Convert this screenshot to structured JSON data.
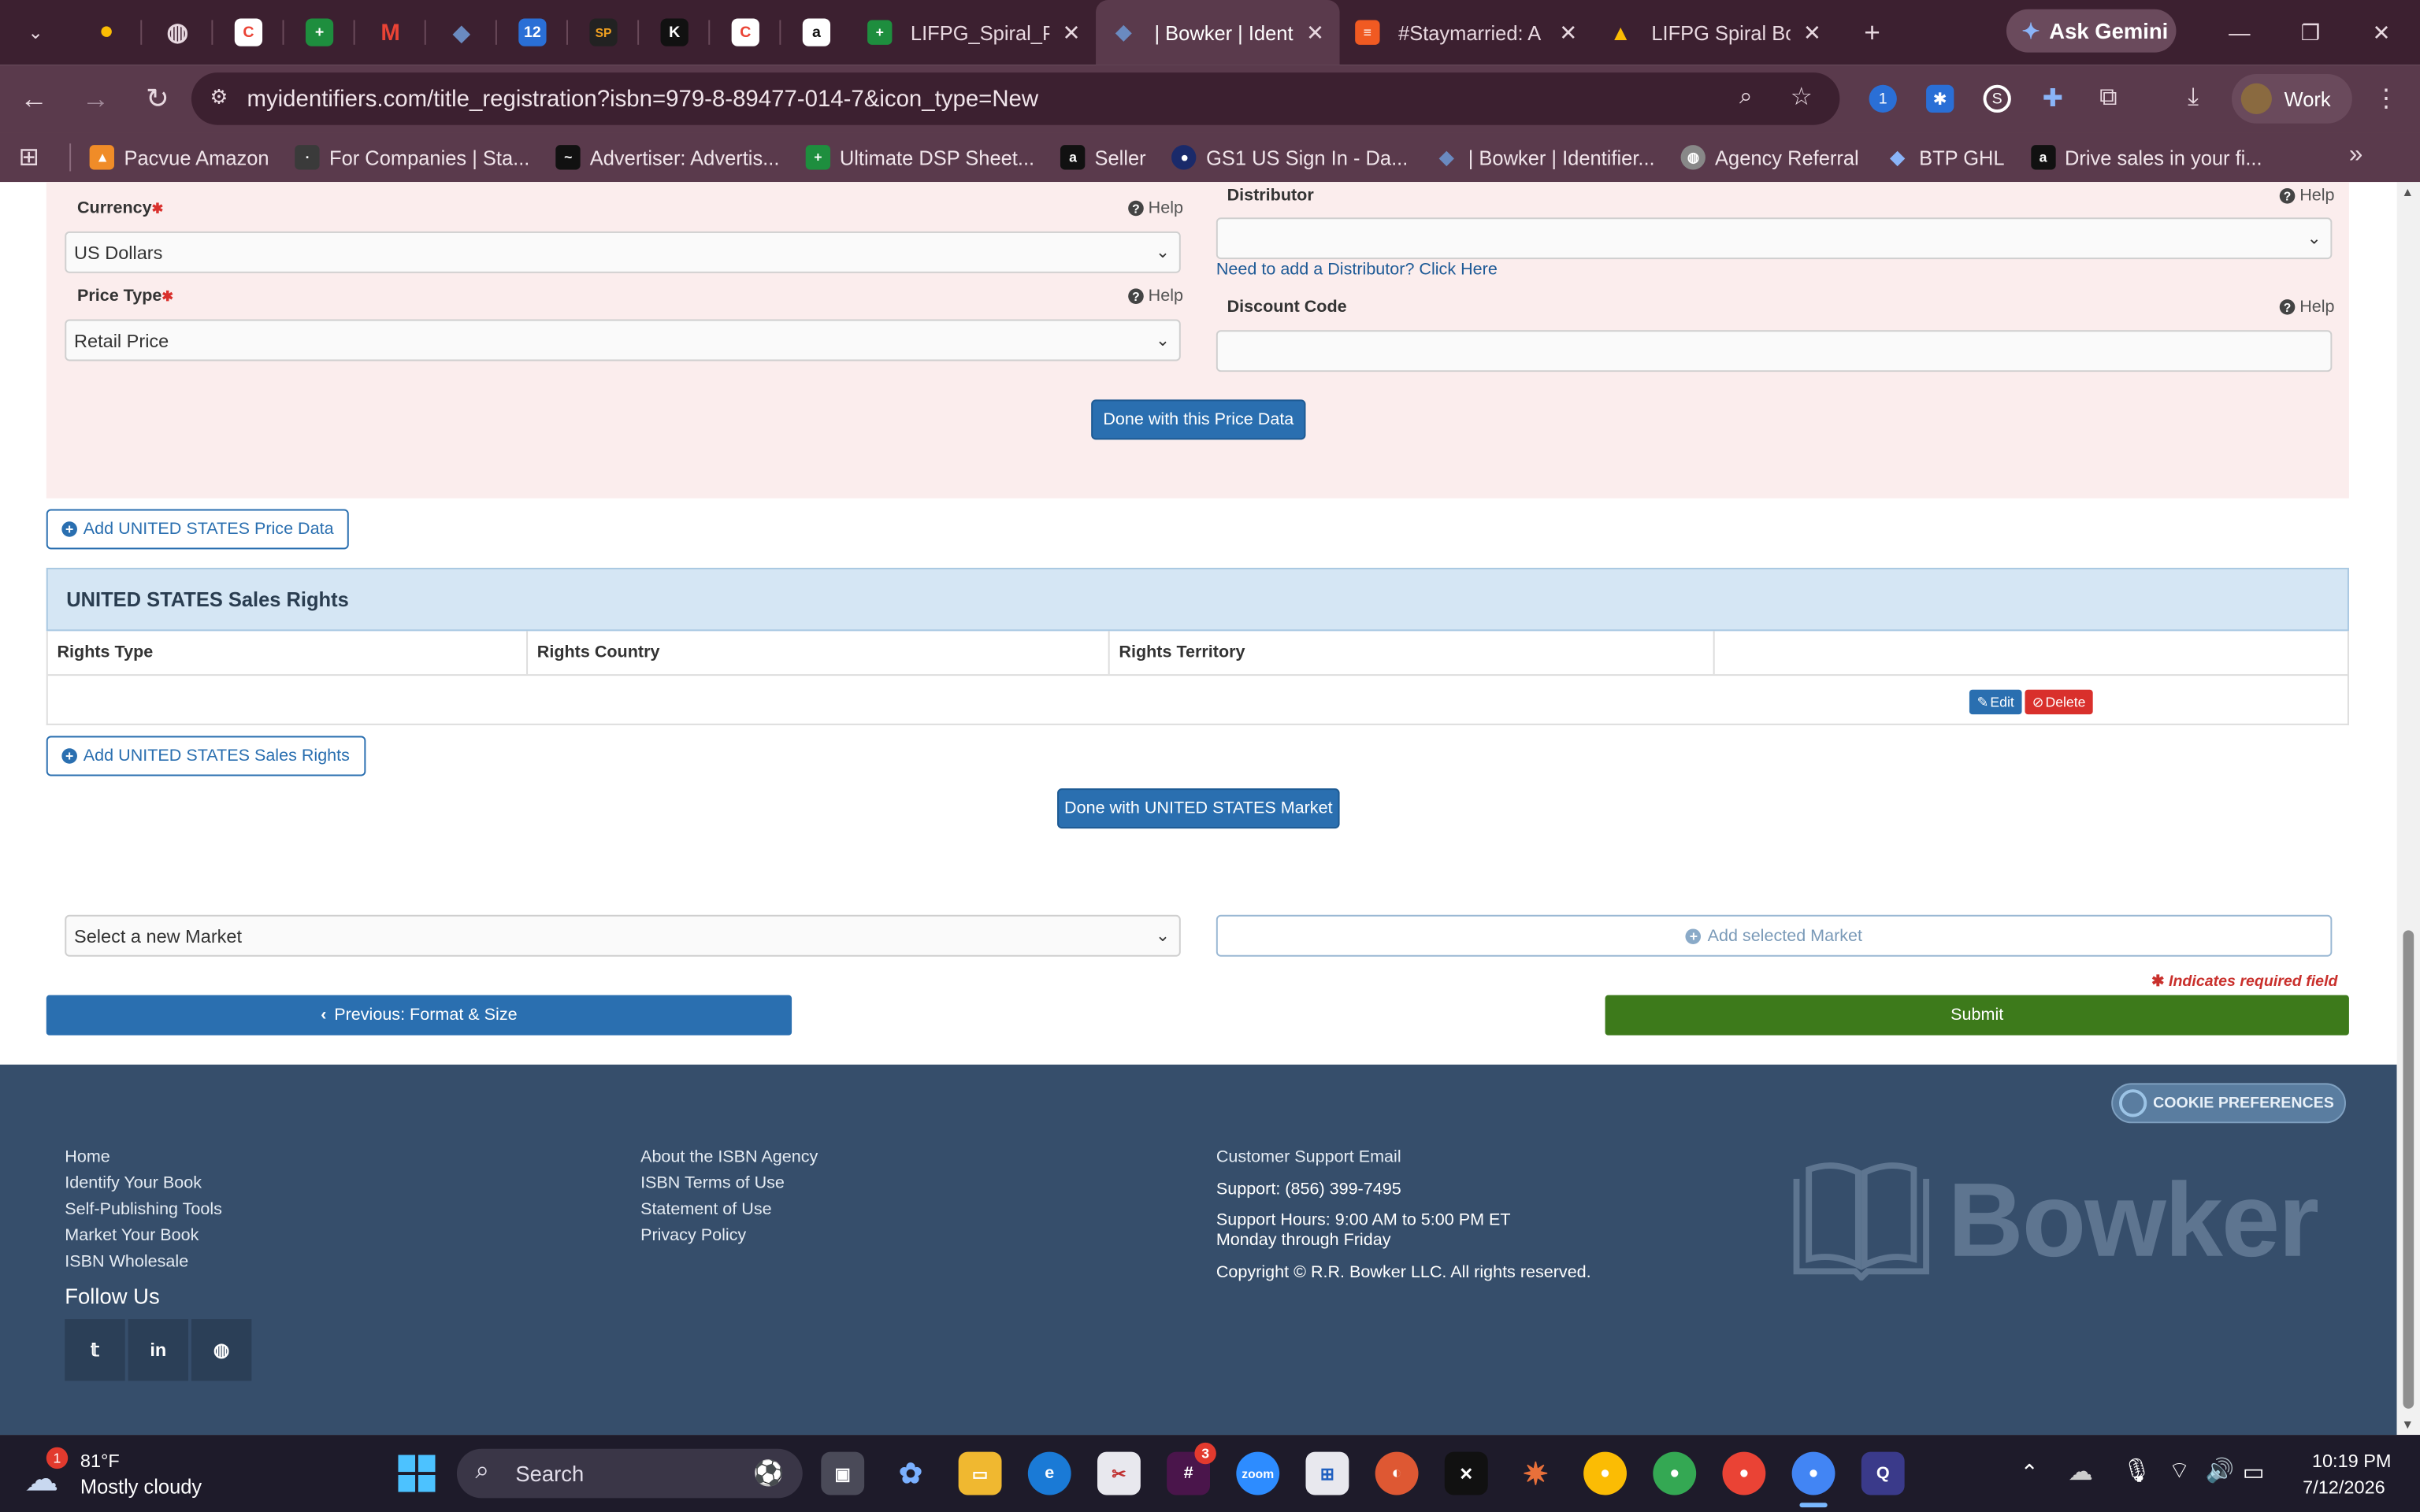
{
  "browser": {
    "tabs": [
      {
        "label": "LIFPG_Spiral_Pip",
        "color": "#1e8e3e",
        "glyph": "+"
      },
      {
        "label": "| Bowker | Identif",
        "color": "#2a6fb0",
        "glyph": "◆"
      },
      {
        "label": "#Staymarried: A",
        "color": "#f05a22",
        "glyph": "≡"
      },
      {
        "label": "LIFPG Spiral Bou",
        "color": "#fbbc04",
        "glyph": "▲"
      }
    ],
    "ask_gemini": "Ask Gemini",
    "url": "myidentifiers.com/title_registration?isbn=979-8-89477-014-7&icon_type=New",
    "profile": "Work",
    "bookmarks": [
      {
        "label": "Pacvue Amazon",
        "color": "#f08c28"
      },
      {
        "label": "For Companies | Sta...",
        "color": "#3a3a3a"
      },
      {
        "label": "Advertiser: Advertis...",
        "color": "#111111"
      },
      {
        "label": "Ultimate DSP Sheet...",
        "color": "#1e8e3e"
      },
      {
        "label": "Seller",
        "color": "#111111"
      },
      {
        "label": "GS1 US Sign In - Da...",
        "color": "#1a2a6a"
      },
      {
        "label": "| Bowker | Identifier...",
        "color": "#2a6fb0"
      },
      {
        "label": "Agency Referral",
        "color": "#888888"
      },
      {
        "label": "BTP GHL",
        "color": "#6a8ac0"
      },
      {
        "label": "Drive sales in your fi...",
        "color": "#111111"
      }
    ]
  },
  "price": {
    "currency_label": "Currency",
    "currency_value": "US Dollars",
    "price_type_label": "Price Type",
    "price_type_value": "Retail Price",
    "distributor_label": "Distributor",
    "distributor_value": "",
    "add_distributor_link": "Need to add a Distributor? Click Here",
    "discount_label": "Discount Code",
    "help": "Help",
    "done_button": "Done with this Price Data"
  },
  "add_price_button": "Add UNITED STATES Price Data",
  "sales_rights": {
    "title": "UNITED STATES Sales Rights",
    "columns": [
      "Rights Type",
      "Rights Country",
      "Rights Territory"
    ],
    "edit": "Edit",
    "delete": "Delete"
  },
  "add_sales_rights_button": "Add UNITED STATES Sales Rights",
  "done_market_button": "Done with UNITED STATES Market",
  "market_select": "Select a new Market",
  "add_market_button": "Add selected Market",
  "required_note": "Indicates required field",
  "prev_button": "Previous: Format & Size",
  "submit_button": "Submit",
  "footer": {
    "col1": [
      "Home",
      "Identify Your Book",
      "Self-Publishing Tools",
      "Market Your Book",
      "ISBN Wholesale"
    ],
    "col2": [
      "About the ISBN Agency",
      "ISBN Terms of Use",
      "Statement of Use",
      "Privacy Policy"
    ],
    "support_email": "Customer Support Email",
    "support_phone": "Support: (856) 399-7495",
    "support_hours": "Support Hours: 9:00 AM to 5:00 PM ET",
    "support_days": "Monday through Friday",
    "copyright": "Copyright © R.R. Bowker LLC. All rights reserved.",
    "follow_us": "Follow Us",
    "cookie": "COOKIE PREFERENCES",
    "brand": "Bowker"
  },
  "taskbar": {
    "temp": "81°F",
    "weather": "Mostly cloudy",
    "search": "Search",
    "time": "10:19 PM",
    "date": "7/12/2026"
  }
}
